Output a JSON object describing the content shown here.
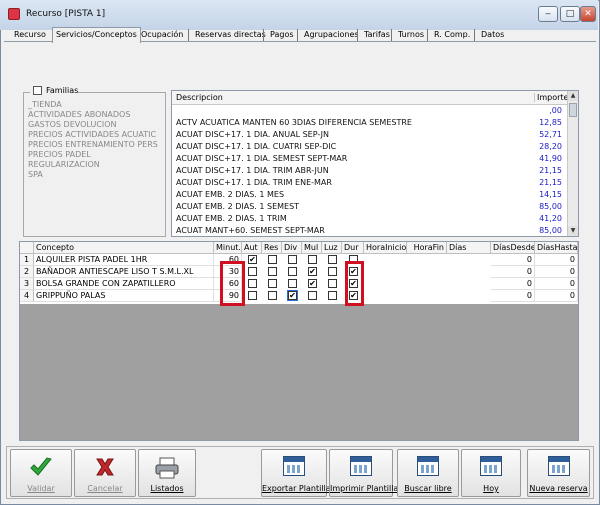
{
  "window": {
    "title": "Recurso [PISTA 1]",
    "minimize": "‒",
    "maximize": "□",
    "close": "✕"
  },
  "tabs": [
    {
      "label": "Recurso",
      "active": false
    },
    {
      "label": "Servicios/Conceptos",
      "active": true
    },
    {
      "label": "Ocupación",
      "active": false
    },
    {
      "label": "Reservas directas",
      "active": false
    },
    {
      "label": "Pagos",
      "active": false
    },
    {
      "label": "Agrupaciones",
      "active": false
    },
    {
      "label": "Tarifas",
      "active": false
    },
    {
      "label": "Turnos",
      "active": false
    },
    {
      "label": "R. Comp.",
      "active": false
    },
    {
      "label": "Datos",
      "active": false
    }
  ],
  "familias": {
    "label": "Familias",
    "checked": false,
    "items": [
      "_TIENDA",
      "ACTIVIDADES ABONADOS",
      "GASTOS DEVOLUCION",
      "PRECIOS ACTIVIDADES ACUATIC",
      "PRECIOS ENTRENAMIENTO PERS",
      "PRECIOS PADEL",
      "REGULARIZACION",
      "SPA"
    ]
  },
  "descripcion": {
    "header_desc": "Descripcion",
    "header_importe": "Importe",
    "rows": [
      {
        "desc": "",
        "importe": ",00"
      },
      {
        "desc": "ACTV ACUATICA MANTEN 60 3DIAS DIFERENCIA SEMESTRE",
        "importe": "12,85"
      },
      {
        "desc": "ACUAT DISC+17. 1 DIA. ANUAL SEP-JN",
        "importe": "52,71"
      },
      {
        "desc": "ACUAT DISC+17. 1 DIA. CUATRI SEP-DIC",
        "importe": "28,20"
      },
      {
        "desc": "ACUAT DISC+17. 1 DIA. SEMEST SEPT-MAR",
        "importe": "41,90"
      },
      {
        "desc": "ACUAT DISC+17. 1 DIA. TRIM ABR-JUN",
        "importe": "21,15"
      },
      {
        "desc": "ACUAT DISC+17. 1 DIA. TRIM ENE-MAR",
        "importe": "21,15"
      },
      {
        "desc": "ACUAT EMB. 2 DIAS. 1 MES",
        "importe": "14,15"
      },
      {
        "desc": "ACUAT EMB. 2 DIAS. 1 SEMEST",
        "importe": "85,00"
      },
      {
        "desc": "ACUAT EMB. 2 DIAS. 1 TRIM",
        "importe": "41,20"
      },
      {
        "desc": "ACUAT MANT+60. SEMEST SEPT-MAR",
        "importe": "85,00"
      }
    ]
  },
  "grid": {
    "headers": [
      "Concepto",
      "Minut.",
      "Aut",
      "Res",
      "Div",
      "Mul",
      "Luz",
      "Dur",
      "HoraInicio",
      "HoraFin",
      "Días",
      "DíasDesde",
      "DíasHasta"
    ],
    "rows": [
      {
        "num": "1",
        "concepto": "ALQUILER PISTA PADEL 1HR",
        "minut": "60",
        "aut": true,
        "res": false,
        "div": false,
        "mul": false,
        "luz": false,
        "dur": false,
        "desde": "0",
        "hasta": "0"
      },
      {
        "num": "2",
        "concepto": "BAÑADOR ANTIESCAPE LISO T S.M.L.XL",
        "minut": "30",
        "aut": false,
        "res": false,
        "div": false,
        "mul": true,
        "luz": false,
        "dur": true,
        "desde": "0",
        "hasta": "0"
      },
      {
        "num": "3",
        "concepto": "BOLSA GRANDE CON ZAPATILLERO",
        "minut": "60",
        "aut": false,
        "res": false,
        "div": false,
        "mul": true,
        "luz": false,
        "dur": true,
        "desde": "0",
        "hasta": "0"
      },
      {
        "num": "4",
        "concepto": "GRIPPUÑO PALAS",
        "minut": "90",
        "aut": false,
        "res": false,
        "div": true,
        "mul": false,
        "luz": false,
        "dur": true,
        "desde": "0",
        "hasta": "0"
      }
    ]
  },
  "toolbar": {
    "validar": "Validar",
    "cancelar": "Cancelar",
    "listados": "Listados",
    "exportar": "Exportar Plantilla",
    "imprimir": "Imprimir Plantilla",
    "buscar": "Buscar libre",
    "hoy": "Hoy",
    "nueva": "Nueva reserva"
  },
  "colors": {
    "amount_blue": "#1a1ac8",
    "highlight_red": "#d01020",
    "grid_gray": "#a0a0a0"
  }
}
